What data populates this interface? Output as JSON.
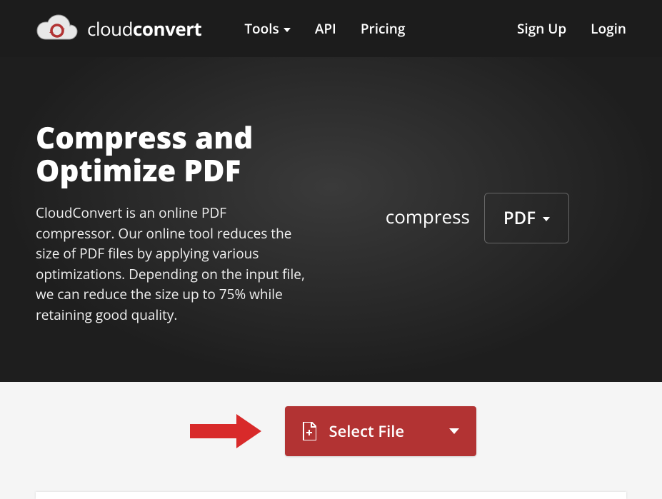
{
  "brand": {
    "light": "cloud",
    "bold": "convert"
  },
  "nav": {
    "tools": "Tools",
    "api": "API",
    "pricing": "Pricing"
  },
  "auth": {
    "signup": "Sign Up",
    "login": "Login"
  },
  "hero": {
    "title": "Compress and Optimize PDF",
    "desc": "CloudConvert is an online PDF compressor. Our online tool reduces the size of PDF files by applying various optimizations. Depending on the input file, we can reduce the size up to 75% while retaining good quality.",
    "compress_label": "compress",
    "format": "PDF"
  },
  "action": {
    "select_file": "Select File"
  }
}
